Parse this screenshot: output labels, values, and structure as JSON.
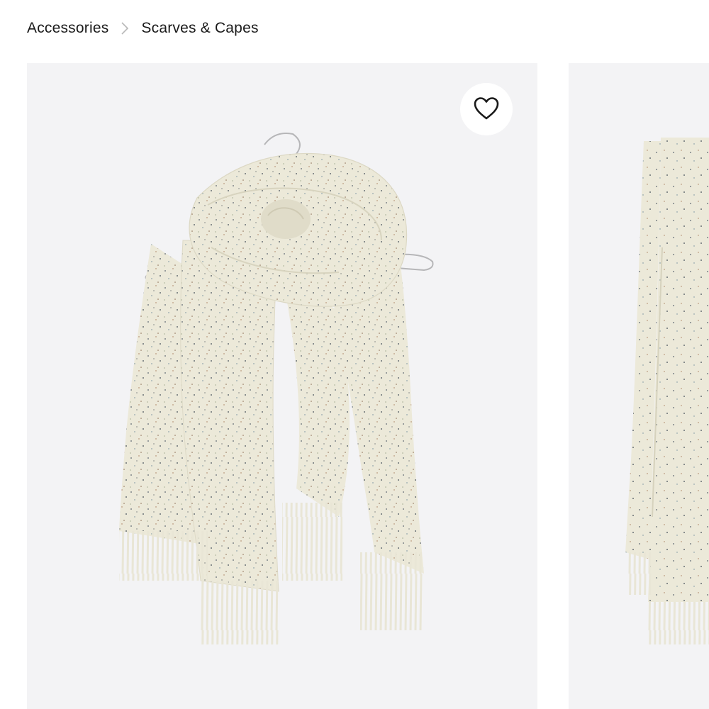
{
  "breadcrumb": {
    "items": [
      {
        "label": "Accessories"
      },
      {
        "label": "Scarves & Capes"
      }
    ],
    "separator_icon": "chevron-right-icon"
  },
  "gallery": {
    "images": [
      {
        "alt": "Speckled cream wool scarf with fringe draped on a wire hanger"
      },
      {
        "alt": "Speckled cream wool scarf laid flat with fringe"
      }
    ],
    "wishlist_icon": "heart-outline-icon",
    "wishlist_label": "Add to wishlist"
  },
  "colors": {
    "background": "#ffffff",
    "image_background": "#f3f3f5",
    "scarf": "#ece9d9",
    "text": "#1a1a1a"
  }
}
